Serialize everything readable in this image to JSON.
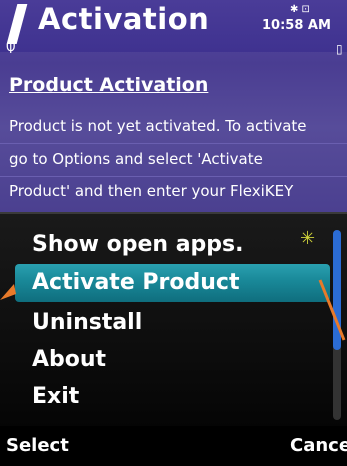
{
  "header": {
    "title": "Activation",
    "time": "10:58 AM",
    "status_icons": "✱ ⊡"
  },
  "content": {
    "section_title": "Product Activation",
    "message_lines": [
      "Product is not yet activated. To activate",
      "go to Options and select 'Activate",
      "Product' and then enter your FlexiKEY"
    ]
  },
  "menu": {
    "items": [
      {
        "label": "Show open apps.",
        "selected": false
      },
      {
        "label": "Activate Product",
        "selected": true
      },
      {
        "label": "Uninstall",
        "selected": false
      },
      {
        "label": "About",
        "selected": false
      },
      {
        "label": "Exit",
        "selected": false
      }
    ],
    "shortcut_icon": "✳"
  },
  "softkeys": {
    "left": "Select",
    "right": "Cancel"
  },
  "colors": {
    "header_bg": "#4a3c98",
    "highlight": "#1a8a9a",
    "scroll_thumb": "#2b6cd4",
    "annotation_arrow": "#e87a2a"
  }
}
